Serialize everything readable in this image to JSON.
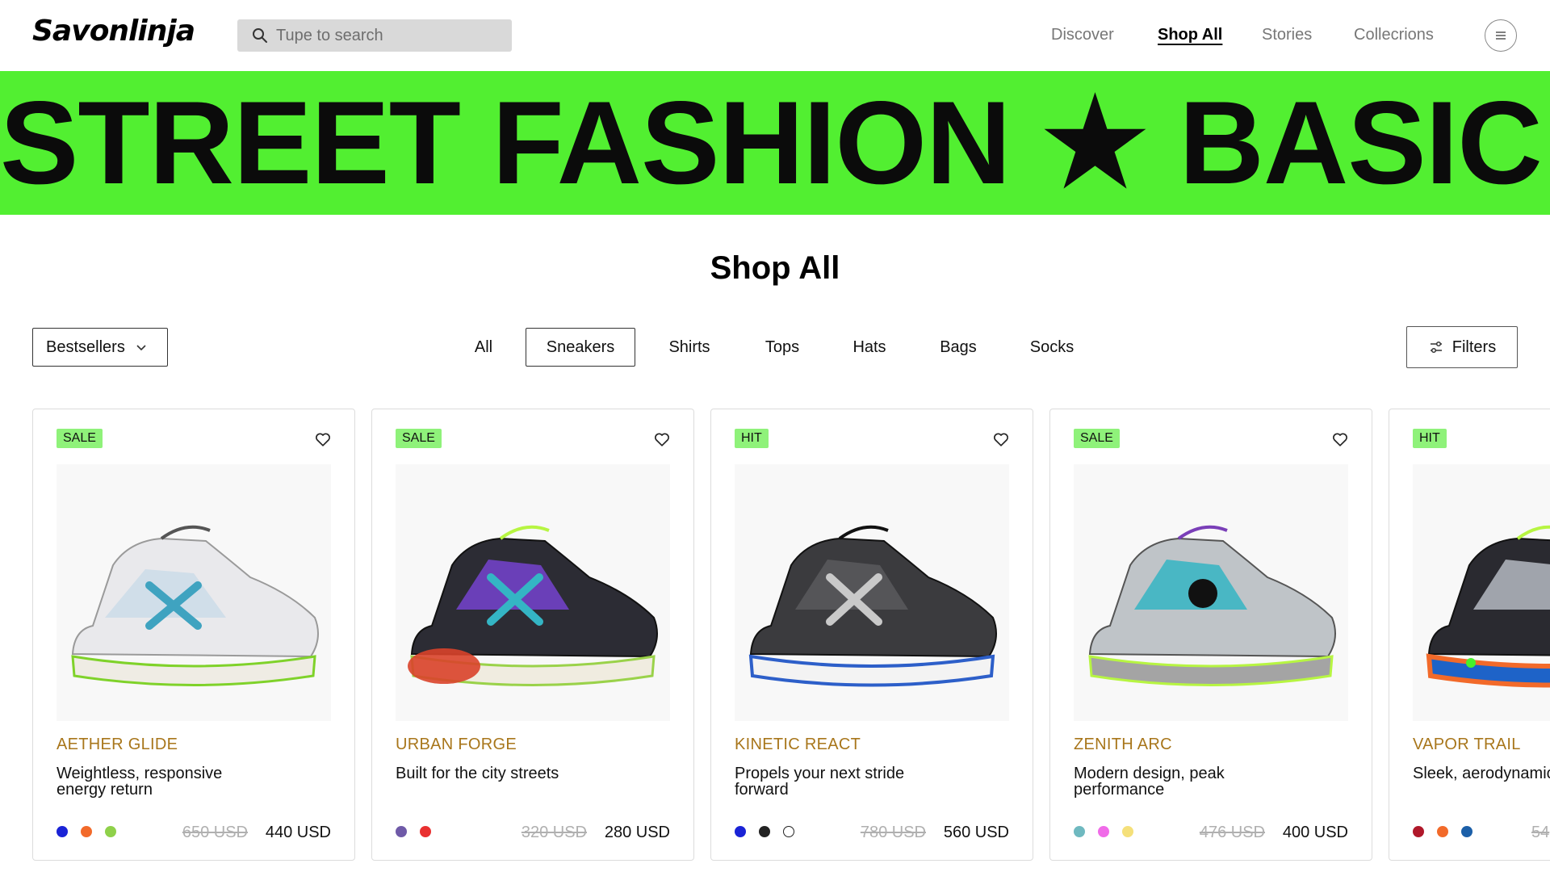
{
  "brand": {
    "logo": "Savonlinja"
  },
  "search": {
    "placeholder": "Tupe to search"
  },
  "nav": [
    "Discover",
    "Shop All",
    "Stories",
    "Collecrions"
  ],
  "banner": {
    "text": "STREET FASHION ★ BASIC ★ S"
  },
  "page": {
    "title": "Shop All"
  },
  "sort": {
    "label": "Bestsellers"
  },
  "categories": [
    "All",
    "Sneakers",
    "Shirts",
    "Tops",
    "Hats",
    "Bags",
    "Socks"
  ],
  "selected_category": "Sneakers",
  "filters": {
    "label": "Filters"
  },
  "colors": {
    "accent": "#52ef31",
    "badge": "#8ff27a",
    "product_name": "#a8761b"
  },
  "products": [
    {
      "badge": "SALE",
      "name": "AETHER GLIDE",
      "desc": "Weightless, responsive energy return",
      "old_price": "650 USD",
      "price": "440 USD",
      "swatches": [
        "#1a23d6",
        "#f26a2a",
        "#8fd14a"
      ]
    },
    {
      "badge": "SALE",
      "name": "URBAN FORGE",
      "desc": "Built for the city streets",
      "old_price": "320 USD",
      "price": "280 USD",
      "swatches": [
        "#6f5aa8",
        "#e93030"
      ]
    },
    {
      "badge": "HIT",
      "name": "KINETIC REACT",
      "desc": "Propels your next stride forward",
      "old_price": "780 USD",
      "price": "560 USD",
      "swatches": [
        "#1a23d6",
        "#222222",
        "#ffffff"
      ]
    },
    {
      "badge": "SALE",
      "name": "ZENITH ARC",
      "desc": "Modern design, peak performance",
      "old_price": "476 USD",
      "price": "400 USD",
      "swatches": [
        "#6fb9c0",
        "#f06be8",
        "#f5e07a"
      ]
    },
    {
      "badge": "HIT",
      "name": "VAPOR TRAIL",
      "desc": "Sleek, aerodynamic",
      "old_price": "54",
      "price": "",
      "swatches": [
        "#b0182a",
        "#f26a2a",
        "#1b5fa8"
      ]
    }
  ]
}
